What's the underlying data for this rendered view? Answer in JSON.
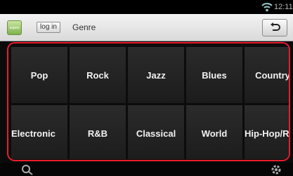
{
  "status_bar": {
    "time": "12:11"
  },
  "header": {
    "app_icon_text": "aupeo",
    "login_label": "log in",
    "title": "Genre"
  },
  "genres": [
    "Pop",
    "Rock",
    "Jazz",
    "Blues",
    "Country",
    "Electronic",
    "R&B",
    "Classical",
    "World",
    "Hip-Hop/Rap"
  ],
  "colors": {
    "highlight_border": "#e81c2c",
    "tile_bg": "#242424",
    "header_bg": "#e6e6e6"
  },
  "icons": {
    "back": "back-arrow-icon",
    "wifi": "wifi-icon",
    "search": "search-icon",
    "settings": "settings-icon"
  }
}
